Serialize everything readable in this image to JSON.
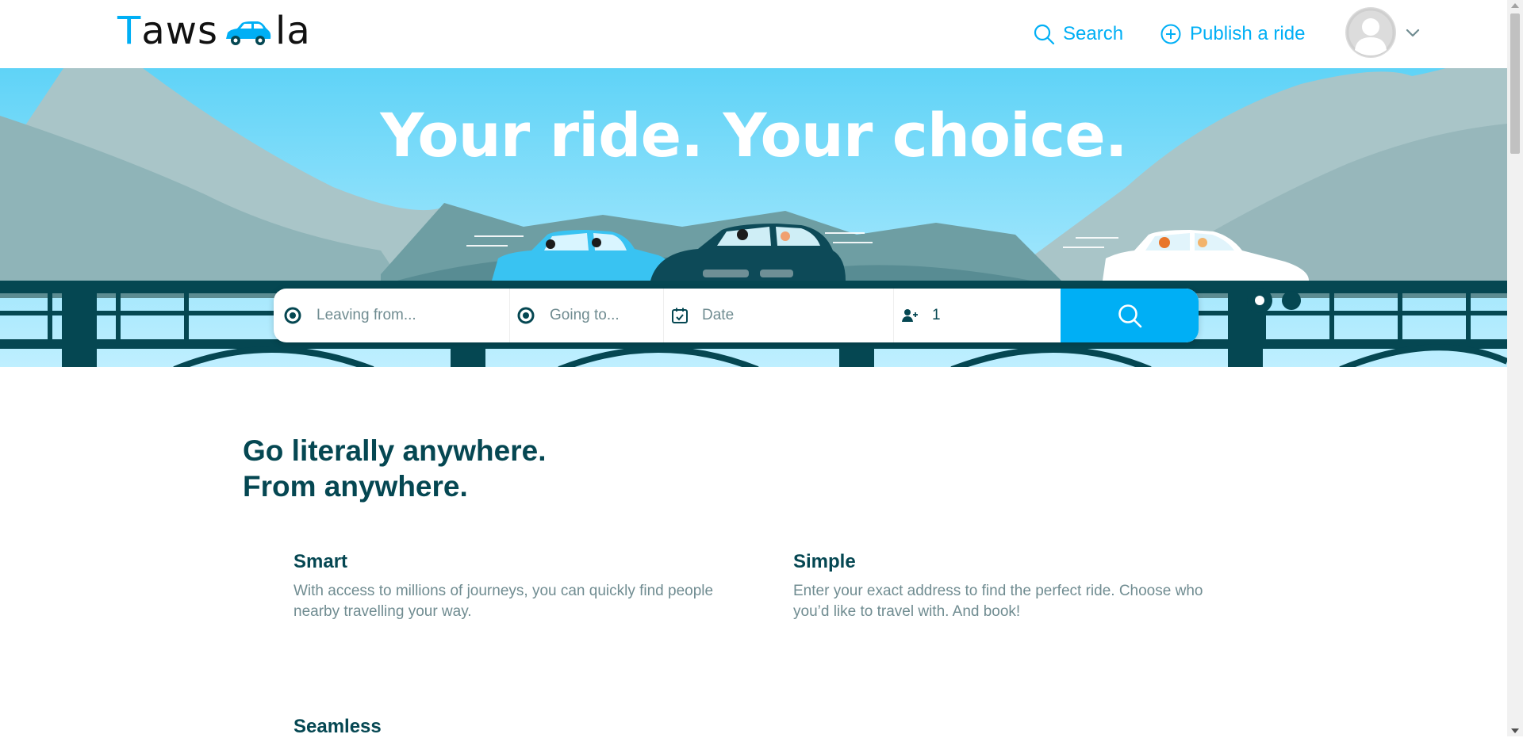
{
  "header": {
    "logo_prefix": "T",
    "logo_mid": "aws",
    "logo_suffix": "la",
    "nav": {
      "search_label": "Search",
      "publish_label": "Publish a ride"
    },
    "icons": [
      "search-icon",
      "plus-circle-icon",
      "user-avatar-icon",
      "chevron-down-icon"
    ]
  },
  "hero": {
    "title": "Your ride. Your choice."
  },
  "search_bar": {
    "from_placeholder": "Leaving from...",
    "to_placeholder": "Going to...",
    "date_placeholder": "Date",
    "passengers": "1",
    "icons": [
      "origin-dot-icon",
      "destination-dot-icon",
      "calendar-icon",
      "add-passenger-icon",
      "search-icon"
    ]
  },
  "content": {
    "title_line1": "Go literally anywhere.",
    "title_line2": "From anywhere.",
    "features": [
      {
        "title": "Smart",
        "text": "With access to millions of journeys, you can quickly find people nearby travelling your way."
      },
      {
        "title": "Simple",
        "text": "Enter your exact address to find the perfect ride. Choose who you’d like to travel with. And book!"
      },
      {
        "title": "Seamless",
        "text": ""
      }
    ]
  },
  "colors": {
    "accent": "#00aff5",
    "heading": "#054752",
    "muted": "#708c91",
    "sky_top": "#5fd3f7",
    "bridge": "#054752"
  }
}
